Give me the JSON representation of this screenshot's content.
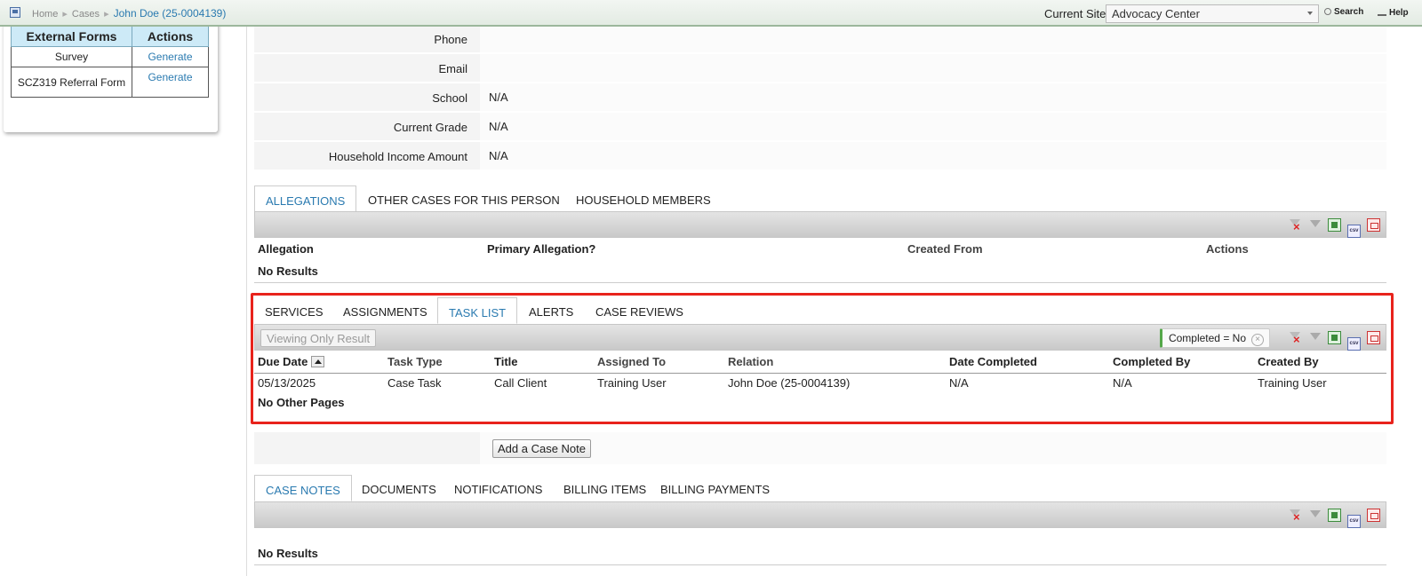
{
  "topbar": {
    "breadcrumb": [
      "Home",
      "Cases",
      "John Doe (25-0004139)"
    ],
    "site_label": "Current Site",
    "site_value": "Advocacy Center",
    "search_label": "Search",
    "help_label": "Help"
  },
  "external_forms": {
    "headers": [
      "External Forms",
      "Actions"
    ],
    "rows": [
      {
        "name": "Survey",
        "action": "Generate"
      },
      {
        "name": "SCZ319 Referral Form",
        "action": "Generate"
      }
    ]
  },
  "person_info": [
    {
      "label": "Phone",
      "value": ""
    },
    {
      "label": "Email",
      "value": ""
    },
    {
      "label": "School",
      "value": "N/A"
    },
    {
      "label": "Current Grade",
      "value": "N/A"
    },
    {
      "label": "Household Income Amount",
      "value": "N/A"
    }
  ],
  "allegations_section": {
    "tabs": [
      "ALLEGATIONS",
      "OTHER CASES FOR THIS PERSON",
      "HOUSEHOLD MEMBERS"
    ],
    "active_tab": "ALLEGATIONS",
    "columns": [
      "Allegation",
      "Primary Allegation?",
      "Created From",
      "Actions"
    ],
    "empty_text": "No Results"
  },
  "tasks_section": {
    "tabs": [
      "SERVICES",
      "ASSIGNMENTS",
      "TASK LIST",
      "ALERTS",
      "CASE REVIEWS"
    ],
    "active_tab": "TASK LIST",
    "viewing_label": "Viewing Only Result",
    "filter_chip": "Completed = No",
    "columns": [
      "Due Date",
      "Task Type",
      "Title",
      "Assigned To",
      "Relation",
      "Date Completed",
      "Completed By",
      "Created By"
    ],
    "rows": [
      {
        "due_date": "05/13/2025",
        "task_type": "Case Task",
        "title": "Call Client",
        "assigned_to": "Training User",
        "relation": "John Doe (25-0004139)",
        "date_completed": "N/A",
        "completed_by": "N/A",
        "created_by": "Training User"
      }
    ],
    "footer_text": "No Other Pages"
  },
  "case_note": {
    "button_label": "Add a Case Note"
  },
  "notes_section": {
    "tabs": [
      "CASE NOTES",
      "DOCUMENTS",
      "NOTIFICATIONS",
      "BILLING ITEMS",
      "BILLING PAYMENTS"
    ],
    "active_tab": "CASE NOTES",
    "empty_text": "No Results"
  },
  "toolbar_icons": [
    "clear-filters-icon",
    "filter-icon",
    "excel-export-icon",
    "csv-export-icon",
    "pdf-export-icon"
  ],
  "colors": {
    "link": "#2a7ab0",
    "highlight": "#e8231c",
    "header_bg": "#cdeaf7"
  }
}
